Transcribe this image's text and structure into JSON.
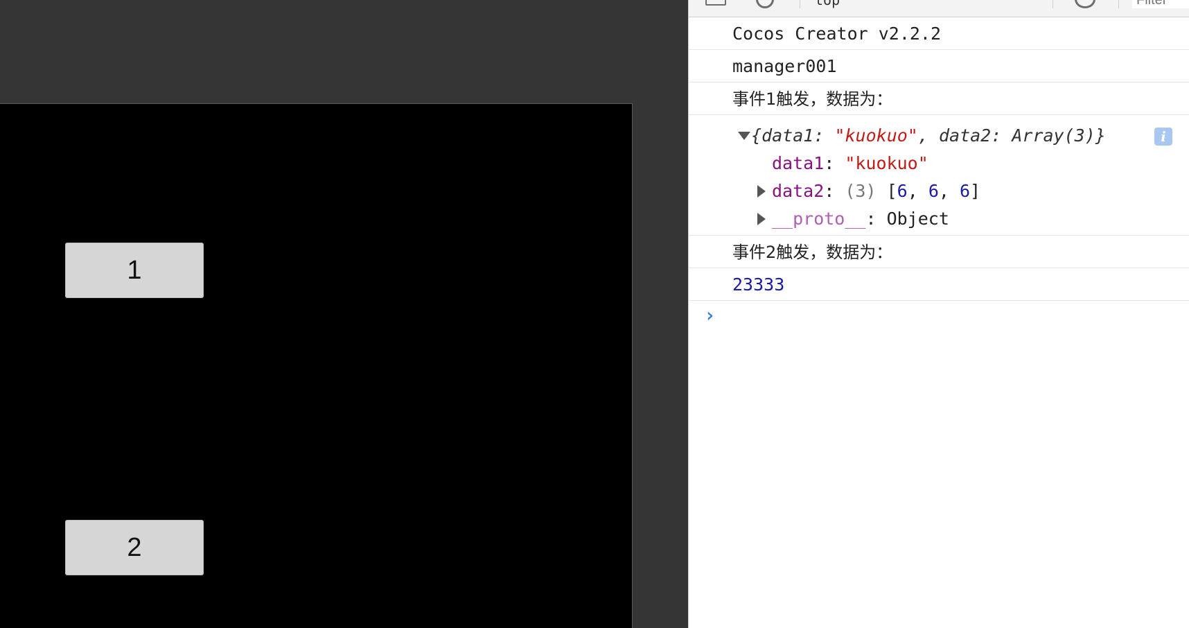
{
  "game": {
    "buttons": [
      {
        "label": "1"
      },
      {
        "label": "2"
      }
    ]
  },
  "toolbar": {
    "context": "top",
    "filter_placeholder": "Filter"
  },
  "console": {
    "messages": [
      {
        "text": "Cocos Creator v2.2.2"
      },
      {
        "text": "manager001"
      },
      {
        "text": "事件1触发，数据为："
      }
    ],
    "object": {
      "open": "{",
      "k1": "data1",
      "v1": "\"kuokuo\"",
      "sep": ", ",
      "k2": "data2",
      "v2": "Array(3)",
      "close": "}",
      "info_icon": "i",
      "prop1": {
        "name": "data1",
        "value": "\"kuokuo\""
      },
      "prop2": {
        "name": "data2",
        "count": "(3)",
        "items": [
          "6",
          "6",
          "6"
        ]
      },
      "proto": {
        "name": "__proto__",
        "value": "Object"
      }
    },
    "message_event2": "事件2触发，数据为：",
    "number_value": "23333",
    "prompt_symbol": "›"
  },
  "colors": {
    "prompt": "#3b7ddd",
    "string": "#c41a16",
    "number": "#1a1aa6",
    "property": "#881280"
  }
}
